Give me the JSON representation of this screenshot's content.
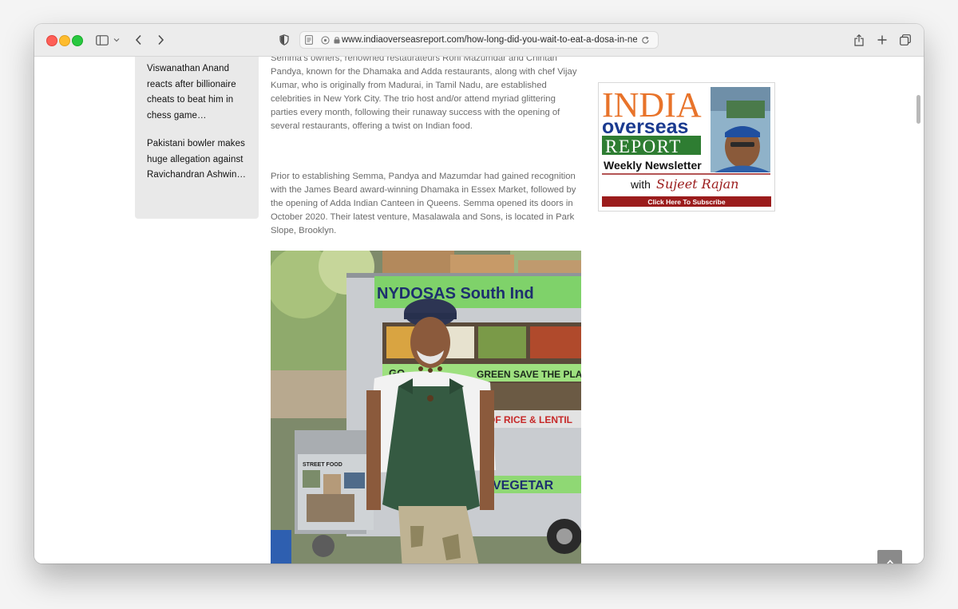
{
  "browser": {
    "url": "www.indiaoverseasreport.com/how-long-did-you-wait-to-eat-a-dosa-in-new-y"
  },
  "sidebar": {
    "links": [
      "Viswanathan Anand reacts after billionaire cheats to beat him in chess game…",
      "Pakistani bowler makes huge allegation against Ravichandran Ashwin…"
    ]
  },
  "article": {
    "paragraphs": [
      "Semma’s owners, renowned restaurateurs Roni Mazumdar and Chintan Pandya, known for the Dhamaka and Adda restaurants, along with chef Vijay Kumar, who is originally from Madurai, in Tamil Nadu, are established celebrities in New York City. The trio host and/or attend myriad glittering parties every month, following their runaway success with the opening of several restaurants, offering a twist on Indian food.",
      "Prior to establishing Semma, Pandya and Mazumdar had gained recognition with the James Beard award-winning Dhamaka in Essex Market, followed by the opening of Adda Indian Canteen in Queens. Semma opened its doors in October 2020. Their latest venture, Masalawala and Sons, is located in Park Slope, Brooklyn."
    ],
    "photo_signs": {
      "top": "NYDOSAS South Ind",
      "middle": "GREEN SAVE THE PLANE",
      "middle_left": "GO",
      "lower": "OF RICE & LENTIL",
      "bottom": "VEGETAR",
      "board": "STREET FOOD"
    }
  },
  "ad": {
    "line1": "INDIA",
    "line2": "overseas",
    "line3": "REPORT",
    "line4": "Weekly Newsletter",
    "with": "with",
    "name": "Sujeet Rajan",
    "cta": "Click Here To Subscribe"
  },
  "colors": {
    "india_orange": "#e8732a",
    "overseas_blue": "#1a3a8f",
    "report_green": "#2e7d32",
    "cta_red": "#9b1c1c"
  }
}
